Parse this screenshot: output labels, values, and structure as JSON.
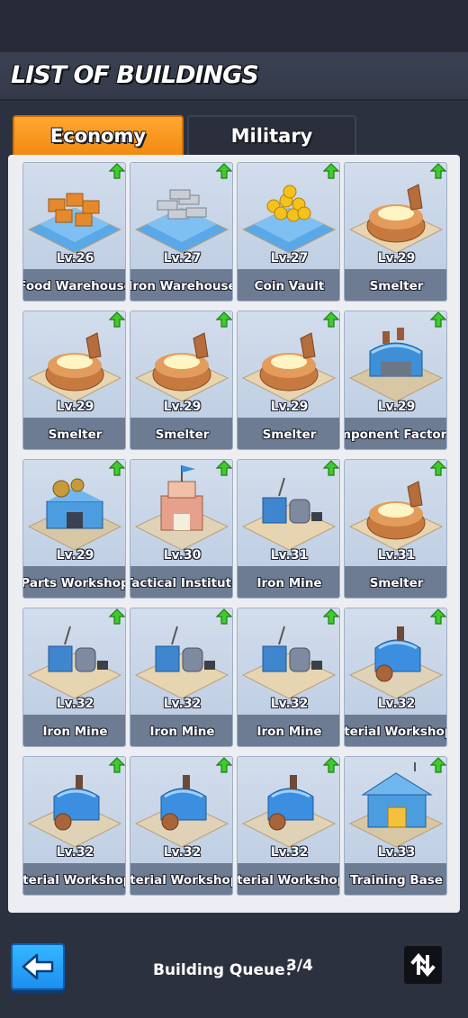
{
  "title": "LIST OF BUILDINGS",
  "tabs": [
    {
      "label": "Economy",
      "active": true
    },
    {
      "label": "Military",
      "active": false
    }
  ],
  "colors": {
    "accent_orange": "#f28a10",
    "upgrade_green": "#35c02a",
    "card_bg": "#c3d1e4",
    "name_bar": "#6e7c93",
    "back_blue": "#1d8ff0"
  },
  "buildings": [
    {
      "level": "Lv.26",
      "name": "Food Warehouse",
      "kind": "food-warehouse"
    },
    {
      "level": "Lv.27",
      "name": "Iron Warehouse",
      "kind": "iron-warehouse"
    },
    {
      "level": "Lv.27",
      "name": "Coin Vault",
      "kind": "coin-vault"
    },
    {
      "level": "Lv.29",
      "name": "Smelter",
      "kind": "smelter"
    },
    {
      "level": "Lv.29",
      "name": "Smelter",
      "kind": "smelter"
    },
    {
      "level": "Lv.29",
      "name": "Smelter",
      "kind": "smelter"
    },
    {
      "level": "Lv.29",
      "name": "Smelter",
      "kind": "smelter"
    },
    {
      "level": "Lv.29",
      "name": "mponent Factory",
      "kind": "component-factory"
    },
    {
      "level": "Lv.29",
      "name": "Parts Workshop",
      "kind": "parts-workshop"
    },
    {
      "level": "Lv.30",
      "name": "Tactical Institute",
      "kind": "tactical-institute"
    },
    {
      "level": "Lv.31",
      "name": "Iron Mine",
      "kind": "iron-mine"
    },
    {
      "level": "Lv.31",
      "name": "Smelter",
      "kind": "smelter"
    },
    {
      "level": "Lv.32",
      "name": "Iron Mine",
      "kind": "iron-mine"
    },
    {
      "level": "Lv.32",
      "name": "Iron Mine",
      "kind": "iron-mine"
    },
    {
      "level": "Lv.32",
      "name": "Iron Mine",
      "kind": "iron-mine"
    },
    {
      "level": "Lv.32",
      "name": "iterial Workshop",
      "kind": "material-workshop"
    },
    {
      "level": "Lv.32",
      "name": "iterial Workshop",
      "kind": "material-workshop"
    },
    {
      "level": "Lv.32",
      "name": "iterial Workshop",
      "kind": "material-workshop"
    },
    {
      "level": "Lv.32",
      "name": "iterial Workshop",
      "kind": "material-workshop"
    },
    {
      "level": "Lv.33",
      "name": "Training Base",
      "kind": "training-base"
    }
  ],
  "footer": {
    "queue_label": "Building Queue：",
    "queue_value": "3/4",
    "back_icon": "arrow-left-icon",
    "sort_icon": "sort-swap-icon"
  }
}
